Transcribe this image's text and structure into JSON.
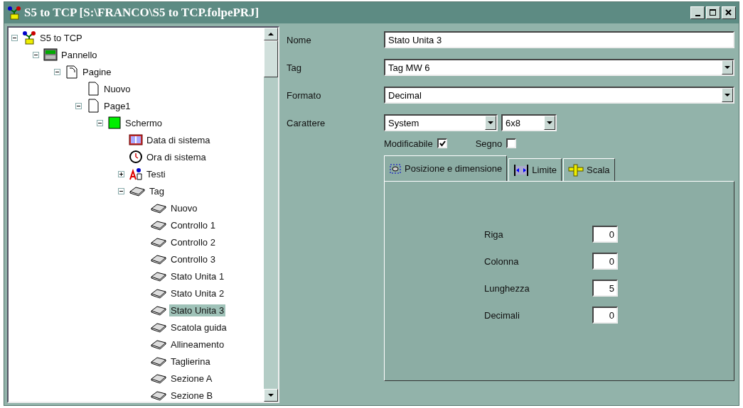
{
  "window": {
    "title": "S5 to TCP [S:\\FRANCO\\S5 to TCP.folpePRJ]"
  },
  "tree": [
    {
      "label": "S5 to TCP",
      "kind": "project",
      "expanded": true,
      "selected": false,
      "children": [
        {
          "label": "Pannello",
          "kind": "panel",
          "expanded": true,
          "selected": false,
          "children": [
            {
              "label": "Pagine",
              "kind": "pages",
              "expanded": true,
              "selected": false,
              "children": [
                {
                  "label": "Nuovo",
                  "kind": "page",
                  "selected": false
                },
                {
                  "label": "Page1",
                  "kind": "page",
                  "expanded": true,
                  "selected": false,
                  "children": [
                    {
                      "label": "Schermo",
                      "kind": "screen",
                      "expanded": true,
                      "selected": false,
                      "children": [
                        {
                          "label": "Data di sistema",
                          "kind": "date",
                          "selected": false
                        },
                        {
                          "label": "Ora di sistema",
                          "kind": "clock",
                          "selected": false
                        },
                        {
                          "label": "Testi",
                          "kind": "text",
                          "expanded": false,
                          "selected": false
                        },
                        {
                          "label": "Tag",
                          "kind": "tag",
                          "expanded": true,
                          "selected": false,
                          "children": [
                            {
                              "label": "Nuovo",
                              "kind": "tag",
                              "selected": false
                            },
                            {
                              "label": "Controllo 1",
                              "kind": "tag",
                              "selected": false
                            },
                            {
                              "label": "Controllo 2",
                              "kind": "tag",
                              "selected": false
                            },
                            {
                              "label": "Controllo 3",
                              "kind": "tag",
                              "selected": false
                            },
                            {
                              "label": "Stato Unita 1",
                              "kind": "tag",
                              "selected": false
                            },
                            {
                              "label": "Stato Unita 2",
                              "kind": "tag",
                              "selected": false
                            },
                            {
                              "label": "Stato Unita 3",
                              "kind": "tag",
                              "selected": true
                            },
                            {
                              "label": "Scatola guida",
                              "kind": "tag",
                              "selected": false
                            },
                            {
                              "label": "Allineamento",
                              "kind": "tag",
                              "selected": false
                            },
                            {
                              "label": "Taglierina",
                              "kind": "tag",
                              "selected": false
                            },
                            {
                              "label": "Sezione A",
                              "kind": "tag",
                              "selected": false
                            },
                            {
                              "label": "Sezione B",
                              "kind": "tag",
                              "selected": false
                            }
                          ]
                        }
                      ]
                    }
                  ]
                }
              ]
            }
          ]
        }
      ]
    }
  ],
  "form": {
    "nome": {
      "label": "Nome",
      "value": "Stato Unita 3"
    },
    "tag": {
      "label": "Tag",
      "value": "Tag MW 6"
    },
    "formato": {
      "label": "Formato",
      "value": "Decimal"
    },
    "carattere": {
      "label": "Carattere",
      "font": "System",
      "size": "6x8"
    },
    "checkboxes": [
      {
        "label": "Modificabile",
        "checked": true
      },
      {
        "label": "Segno",
        "checked": false
      }
    ]
  },
  "tabs": [
    {
      "label": "Posizione e dimensione",
      "kind": "position",
      "selected": true
    },
    {
      "label": "Limite",
      "kind": "limit",
      "selected": false
    },
    {
      "label": "Scala",
      "kind": "scale",
      "selected": false
    }
  ],
  "position_fields": [
    {
      "label": "Riga",
      "value": "0"
    },
    {
      "label": "Colonna",
      "value": "0"
    },
    {
      "label": "Lunghezza",
      "value": "5"
    },
    {
      "label": "Decimali",
      "value": "0"
    }
  ]
}
